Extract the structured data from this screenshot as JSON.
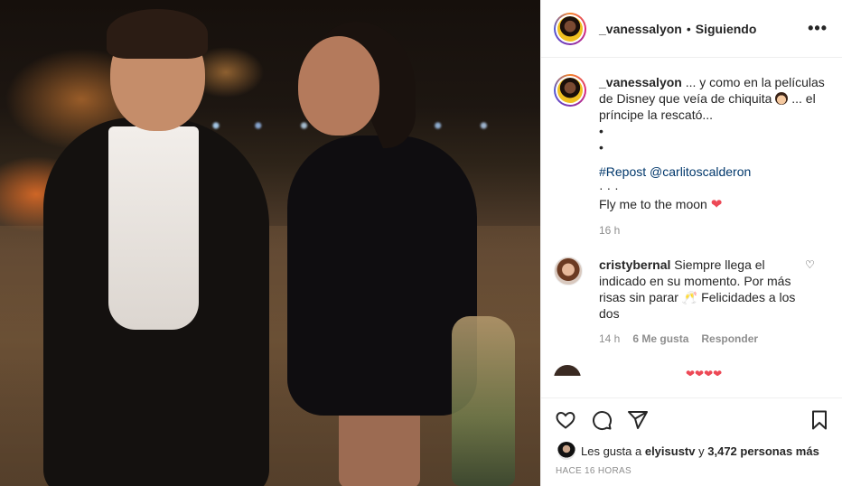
{
  "post": {
    "username": "_vanessalyon",
    "follow_separator": "•",
    "follow_label": "Siguiendo",
    "more_label": "•••"
  },
  "caption": {
    "username": "_vanessalyon",
    "line1": "... y como en la películas de Disney que veía de chiquita",
    "line1_after": "... el príncipe la rescató...",
    "dot1": "•",
    "dot2": "•",
    "repost": "#Repost @carlitoscalderon",
    "dots3": "· · ·",
    "fly_text": "Fly me to the moon",
    "time": "16 h"
  },
  "comment": {
    "username": "cristybernal",
    "text": "Siempre llega el indicado en su momento. Por más risas sin parar",
    "text_after": "Felicidades a los dos",
    "toast_emoji": "🥂",
    "time": "14 h",
    "likes": "6 Me gusta",
    "reply": "Responder"
  },
  "likes": {
    "prefix": "Les gusta a",
    "user": "elyisustv",
    "connector": "y",
    "count": "3,472 personas más"
  },
  "posted_ago": "HACE 16 HORAS",
  "icons": [
    "heart-icon",
    "comment-icon",
    "share-icon",
    "bookmark-icon"
  ],
  "colors": {
    "link": "#00376b",
    "heart": "#ed4956",
    "muted": "#8e8e8e",
    "border": "#efefef"
  }
}
